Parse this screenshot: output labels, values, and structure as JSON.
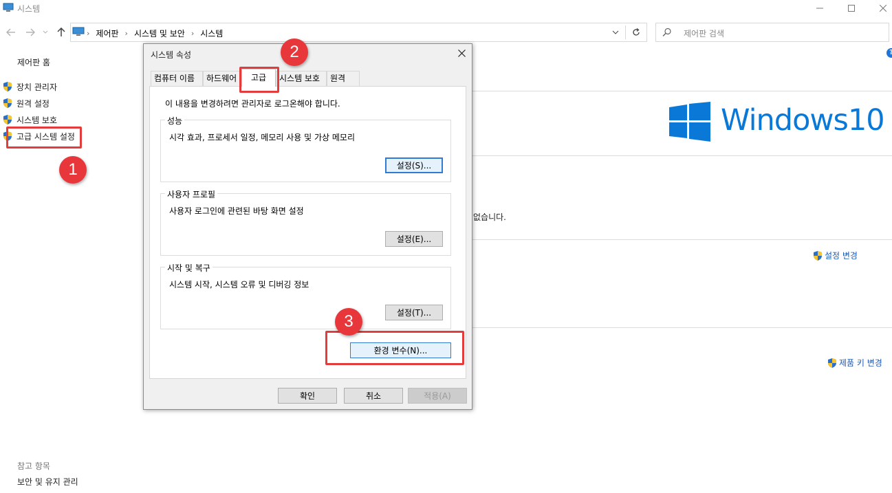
{
  "window": {
    "title": "시스템",
    "controls": {
      "minimize": "minimize-icon",
      "maximize": "maximize-icon",
      "close": "close-icon"
    }
  },
  "address": {
    "breadcrumbs": [
      "제어판",
      "시스템 및 보안",
      "시스템"
    ],
    "search_placeholder": "제어판 검색"
  },
  "sidebar": {
    "home": "제어판 홈",
    "items": [
      {
        "label": "장치 관리자",
        "icon": "shield-icon"
      },
      {
        "label": "원격 설정",
        "icon": "shield-icon"
      },
      {
        "label": "시스템 보호",
        "icon": "shield-icon"
      },
      {
        "label": "고급 시스템 설정",
        "icon": "shield-icon"
      }
    ],
    "see_also_heading": "참고 항목",
    "see_also_items": [
      "보안 및 유지 관리"
    ]
  },
  "main": {
    "brand_text": "Windows10",
    "fragment_text": "없습니다.",
    "links": {
      "change_settings": "설정 변경",
      "change_product_key": "제품 키 변경"
    },
    "help_icon": "help-icon"
  },
  "dialog": {
    "title": "시스템 속성",
    "tabs": [
      "컴퓨터 이름",
      "하드웨어",
      "고급",
      "시스템 보호",
      "원격"
    ],
    "active_tab": "고급",
    "admin_note": "이 내용을 변경하려면 관리자로 로그온해야 합니다.",
    "groups": {
      "performance": {
        "title": "성능",
        "description": "시각 효과, 프로세서 일정, 메모리 사용 및 가상 메모리",
        "button": "설정(S)..."
      },
      "user_profiles": {
        "title": "사용자 프로필",
        "description": "사용자 로그인에 관련된 바탕 화면 설정",
        "button": "설정(E)..."
      },
      "startup_recovery": {
        "title": "시작 및 복구",
        "description": "시스템 시작, 시스템 오류 및 디버깅 정보",
        "button": "설정(T)..."
      }
    },
    "env_button": "환경 변수(N)...",
    "footer": {
      "ok": "확인",
      "cancel": "취소",
      "apply": "적용(A)"
    }
  },
  "annotations": {
    "steps": [
      "1",
      "2",
      "3"
    ],
    "color": "#e8373a"
  },
  "colors": {
    "windows_blue": "#0a78d6",
    "link_blue": "#1a5bb5",
    "focus_blue": "#2f7bd3"
  }
}
